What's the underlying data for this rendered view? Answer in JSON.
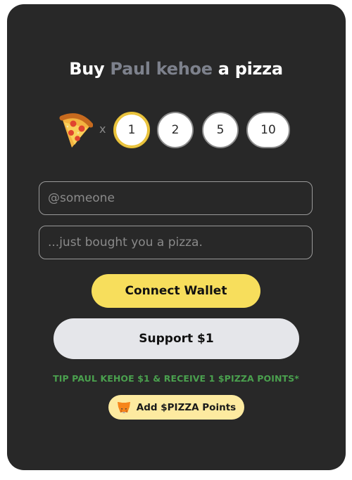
{
  "title": {
    "prefix": "Buy",
    "name": "Paul kehoe",
    "suffix": "a pizza"
  },
  "quantity": {
    "icon": "pizza-icon",
    "times_symbol": "x",
    "options": [
      "1",
      "2",
      "5",
      "10"
    ],
    "selected": "1"
  },
  "form": {
    "name_placeholder": "@someone",
    "message_placeholder": "...just bought you a pizza."
  },
  "buttons": {
    "connect_wallet": "Connect Wallet",
    "support": "Support $1",
    "add_points": "Add $PIZZA Points"
  },
  "tip_text": "TIP PAUL KEHOE $1 & RECEIVE 1 $PIZZA POINTS*",
  "colors": {
    "card_bg": "#282828",
    "accent_yellow": "#f7de5c",
    "name_grey": "#7d818c",
    "tip_green": "#4aa04e",
    "points_bg": "#fdeaa0"
  }
}
